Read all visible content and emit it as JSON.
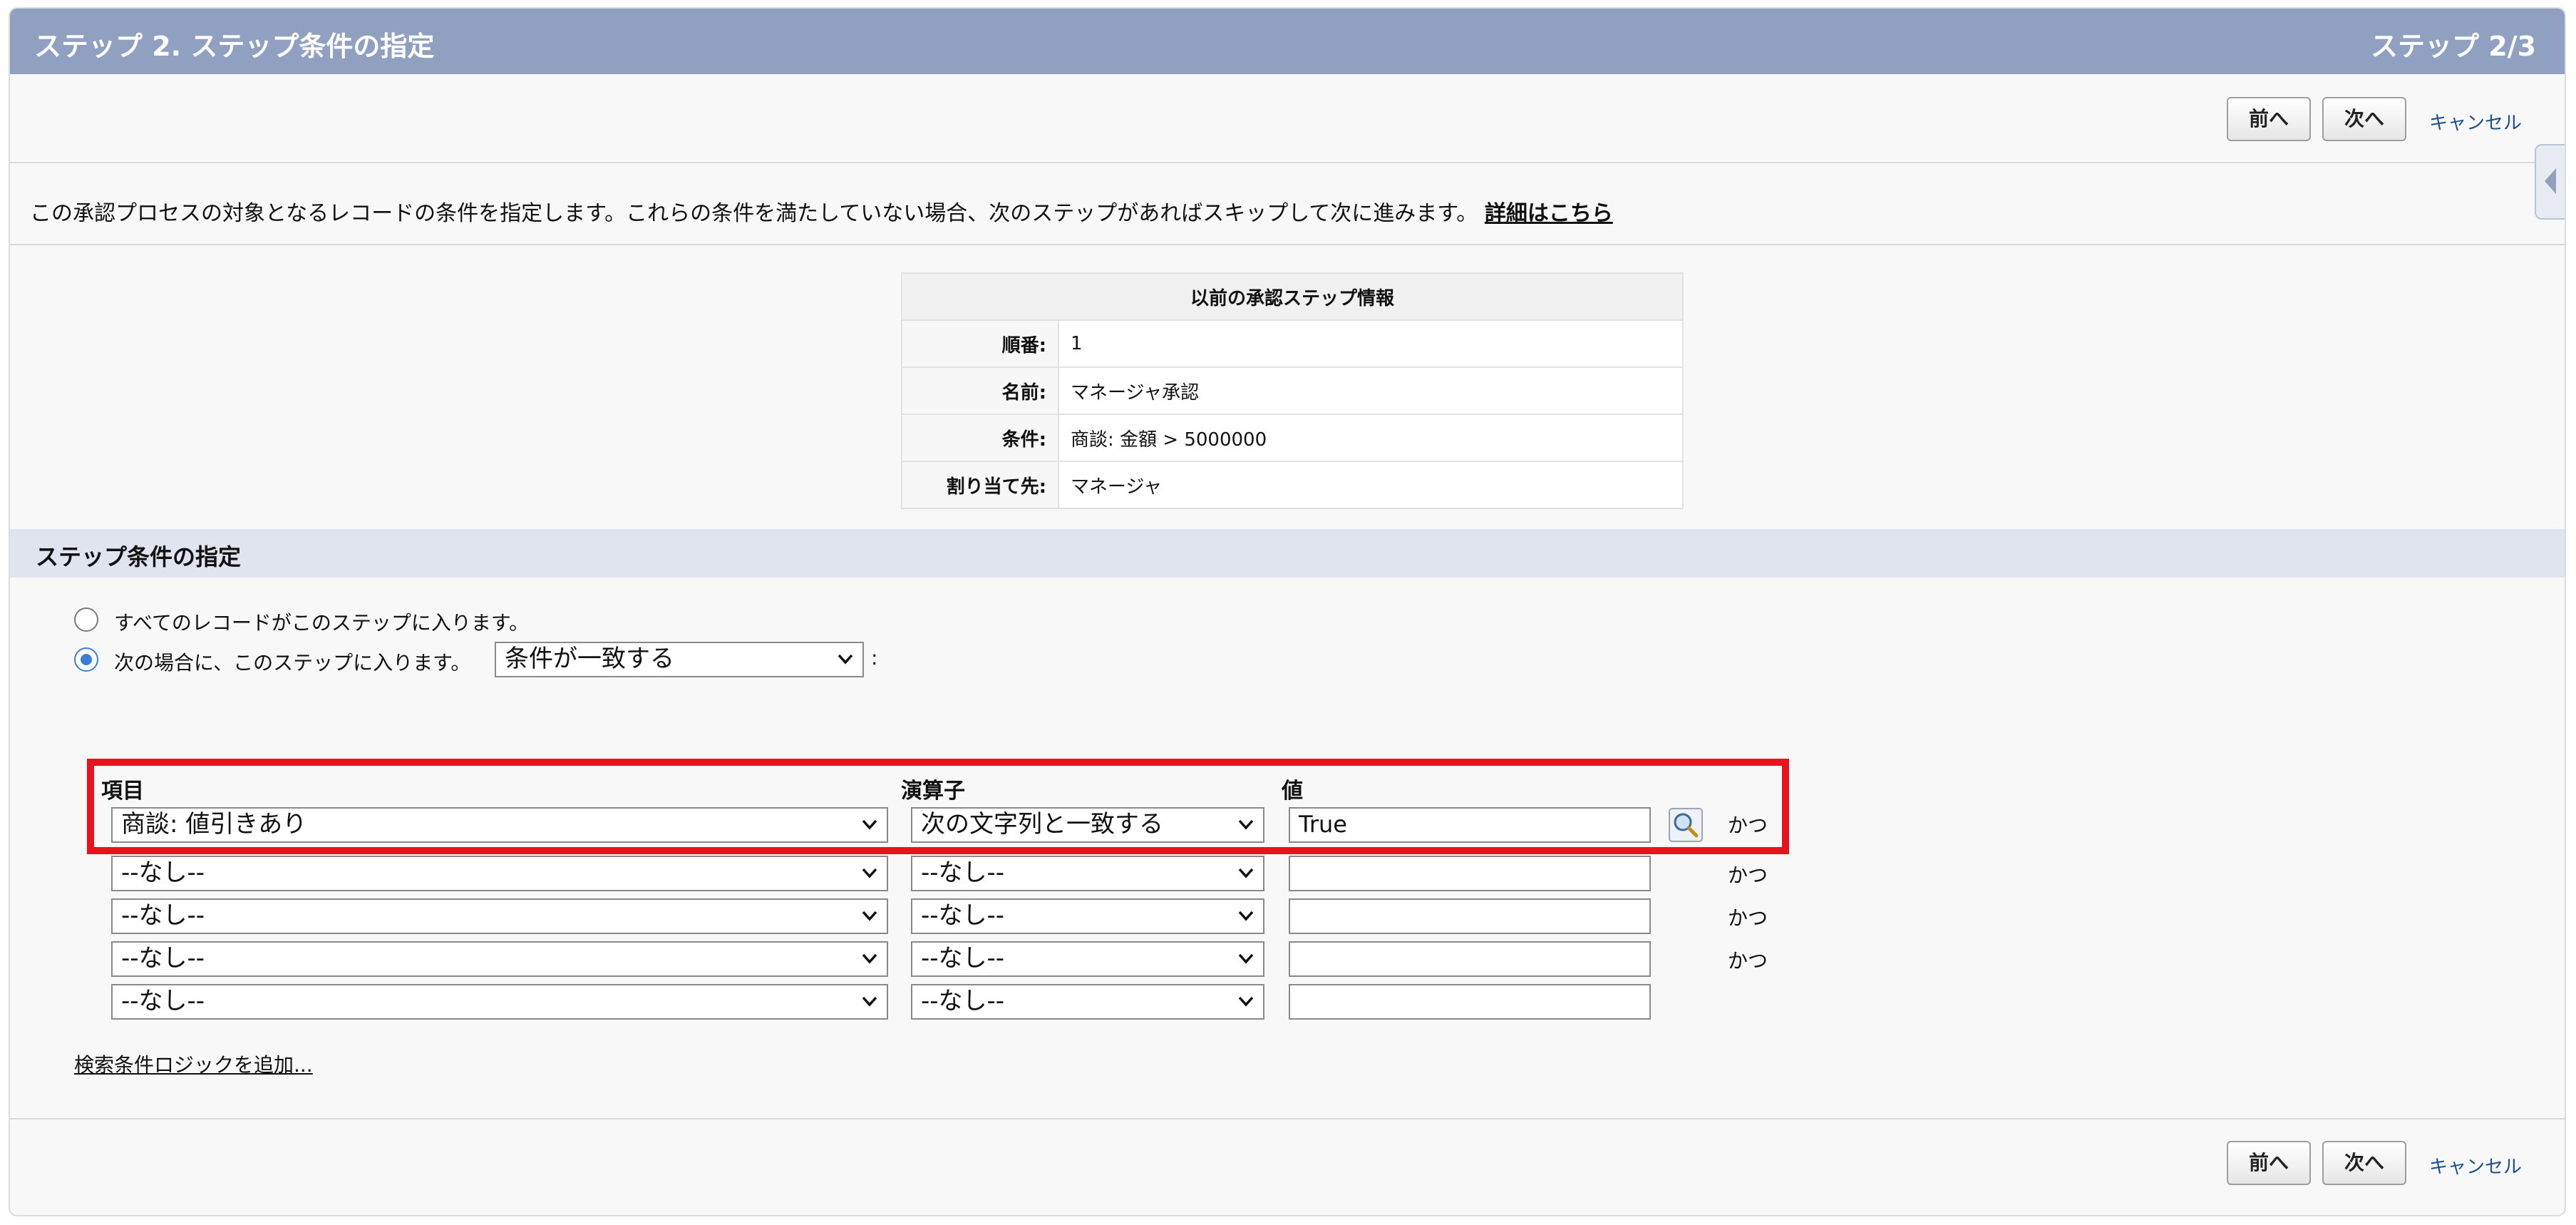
{
  "header": {
    "title": "ステップ 2. ステップ条件の指定",
    "step_indicator": "ステップ 2/3"
  },
  "buttons": {
    "prev": "前へ",
    "next": "次へ",
    "cancel": "キャンセル"
  },
  "description": {
    "text": "この承認プロセスの対象となるレコードの条件を指定します。これらの条件を満たしていない場合、次のステップがあればスキップして次に進みます。",
    "link": "詳細はこちら"
  },
  "previous_step": {
    "header": "以前の承認ステップ情報",
    "rows": [
      {
        "label": "順番:",
        "value": "1"
      },
      {
        "label": "名前:",
        "value": "マネージャ承認"
      },
      {
        "label": "条件:",
        "value": "商談: 金額 > 5000000"
      },
      {
        "label": "割り当て先:",
        "value": "マネージャ"
      }
    ]
  },
  "section": {
    "title": "ステップ条件の指定"
  },
  "options": {
    "all_records": "すべてのレコードがこのステップに入ります。",
    "if_condition": "次の場合に、このステップに入ります。",
    "condition_select": "条件が一致する",
    "colon": ":"
  },
  "criteria": {
    "headers": {
      "field": "項目",
      "operator": "演算子",
      "value": "値"
    },
    "rows": [
      {
        "field": "商談: 値引きあり",
        "operator": "次の文字列と一致する",
        "value": "True",
        "conj": "かつ"
      },
      {
        "field": "--なし--",
        "operator": "--なし--",
        "value": "",
        "conj": "かつ"
      },
      {
        "field": "--なし--",
        "operator": "--なし--",
        "value": "",
        "conj": "かつ"
      },
      {
        "field": "--なし--",
        "operator": "--なし--",
        "value": "",
        "conj": "かつ"
      },
      {
        "field": "--なし--",
        "operator": "--なし--",
        "value": "",
        "conj": ""
      }
    ],
    "add_logic_link": "検索条件ロジックを追加..."
  },
  "colors": {
    "title_bar": "#8fa0c1",
    "highlight": "#e8141d",
    "radio_selected": "#3a7fd5"
  }
}
